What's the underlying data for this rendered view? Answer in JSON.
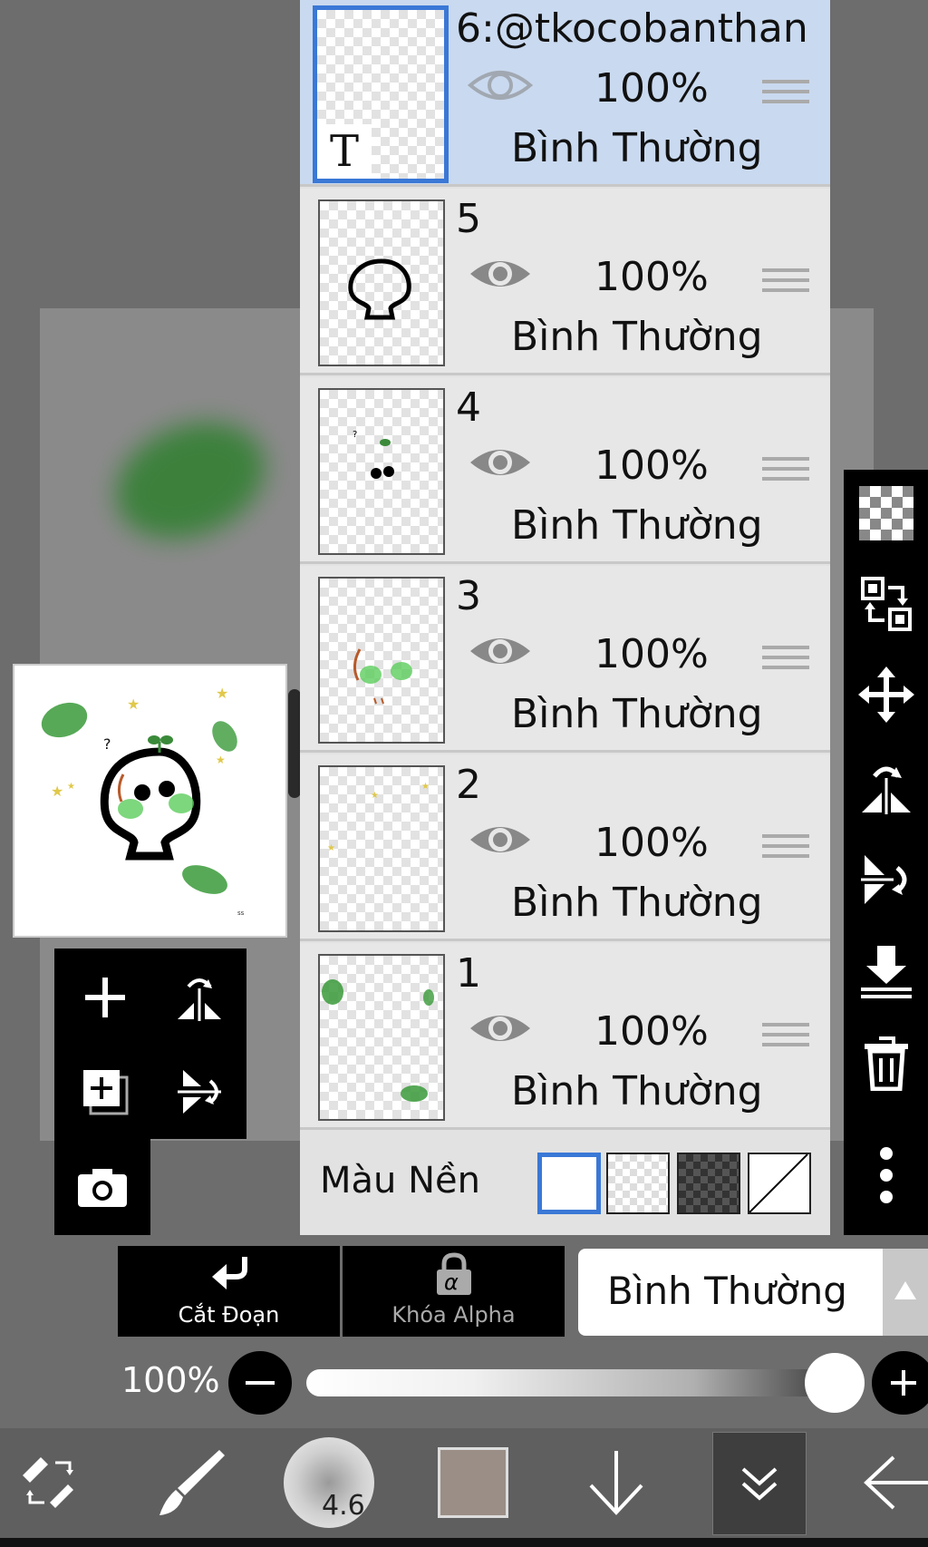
{
  "layers": [
    {
      "name": "6:@tkocobanthan",
      "opacity": "100%",
      "blend": "Bình Thường",
      "selected": true,
      "thumb_text": "T"
    },
    {
      "name": "5",
      "opacity": "100%",
      "blend": "Bình Thường",
      "selected": false
    },
    {
      "name": "4",
      "opacity": "100%",
      "blend": "Bình Thường",
      "selected": false
    },
    {
      "name": "3",
      "opacity": "100%",
      "blend": "Bình Thường",
      "selected": false
    },
    {
      "name": "2",
      "opacity": "100%",
      "blend": "Bình Thường",
      "selected": false
    },
    {
      "name": "1",
      "opacity": "100%",
      "blend": "Bình Thường",
      "selected": false
    }
  ],
  "background": {
    "label": "Màu Nền",
    "selected_option": "white"
  },
  "bottom_buttons": {
    "clip_label": "Cắt Đoạn",
    "alpha_label": "Khóa Alpha",
    "alpha_symbol": "α"
  },
  "blend_mode": {
    "value": "Bình Thường"
  },
  "opacity": {
    "label": "100%",
    "value": 1.0
  },
  "brush": {
    "size": "4.6"
  },
  "colors": {
    "current_color": "#9a8e86",
    "selection": "#3a78d6",
    "leaf_green": "#2f8f2f"
  },
  "icons": {
    "right_toolbar": [
      "transparency-icon",
      "swap-layers-icon",
      "move-icon",
      "flip-horizontal-icon",
      "flip-vertical-icon",
      "merge-down-icon",
      "trash-icon",
      "more-icon"
    ],
    "left_tools": [
      "add-layer-icon",
      "flip-horizontal-icon",
      "copy-layer-icon",
      "flip-vertical-icon",
      "camera-icon"
    ],
    "bottom_bar": [
      "swap-tools-icon",
      "brush-icon",
      "brush-size-icon",
      "color-swatch",
      "arrow-down-icon",
      "layers-toggle-icon",
      "back-icon"
    ]
  }
}
